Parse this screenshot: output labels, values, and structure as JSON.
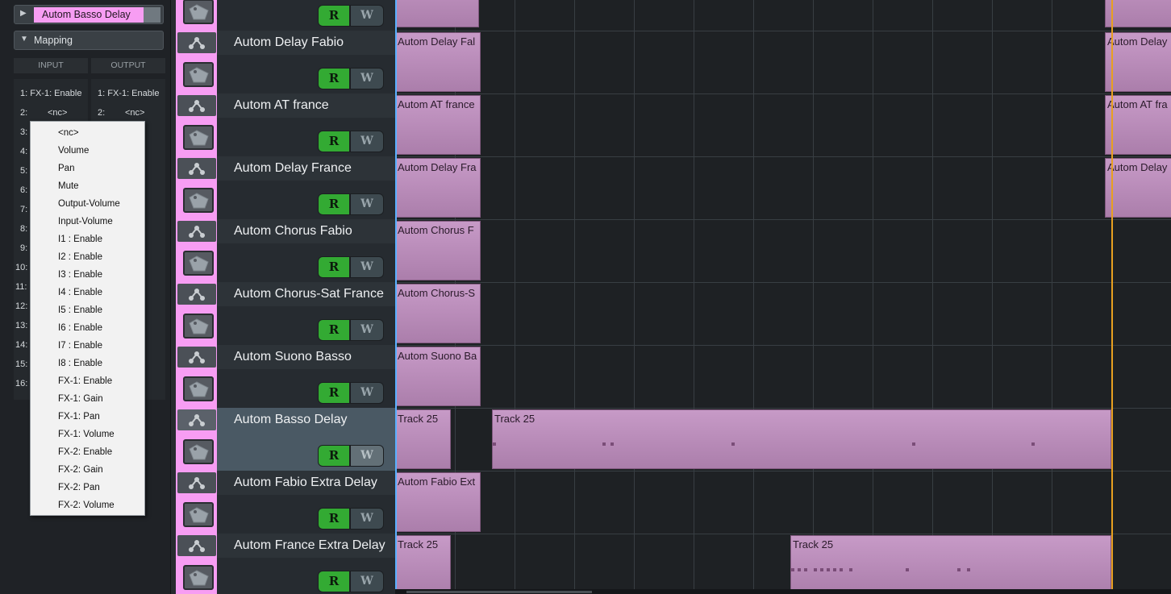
{
  "left_panel": {
    "autom_header": {
      "label": "Autom Basso Delay",
      "expand_icon": "play-triangle"
    },
    "mapping_header": {
      "label": "Mapping",
      "expand_icon": "down-triangle"
    },
    "input_header": "INPUT",
    "output_header": "OUTPUT",
    "input_rows": [
      "1: FX-1: Enable",
      "2:",
      "3:",
      "4:",
      "5:",
      "6:",
      "7:",
      "8:",
      "9:",
      "10:",
      "11:",
      "12:",
      "13:",
      "14:",
      "15:",
      "16:"
    ],
    "input_row2_value": "<nc>",
    "output_rows": [
      "1: FX-1: Enable",
      "2:"
    ],
    "output_row2_value": "<nc>"
  },
  "dropdown": {
    "items": [
      "<nc>",
      "Volume",
      "Pan",
      "Mute",
      "Output-Volume",
      "Input-Volume",
      "I1 : Enable",
      "I2 : Enable",
      "I3 : Enable",
      "I4 : Enable",
      "I5 : Enable",
      "I6 : Enable",
      "I7 : Enable",
      "I8 : Enable",
      "FX-1: Enable",
      "FX-1: Gain",
      "FX-1: Pan",
      "FX-1: Volume",
      "FX-2: Enable",
      "FX-2: Gain",
      "FX-2: Pan",
      "FX-2: Volume"
    ]
  },
  "buttons": {
    "read": "R",
    "write": "W"
  },
  "tracks": [
    {
      "name": ""
    },
    {
      "name": "Autom Delay Fabio"
    },
    {
      "name": "Autom AT france"
    },
    {
      "name": "Autom Delay France"
    },
    {
      "name": "Autom Chorus Fabio"
    },
    {
      "name": "Autom Chorus-Sat France"
    },
    {
      "name": "Autom Suono Basso"
    },
    {
      "name": "Autom Basso Delay",
      "selected": true
    },
    {
      "name": "Autom Fabio Extra Delay"
    },
    {
      "name": "Autom France Extra Delay"
    }
  ],
  "clips": {
    "c0a": "",
    "c0b": "",
    "c1a": "Autom Delay Fal",
    "c1b": "Autom Delay",
    "c2a": "Autom AT france",
    "c2b": "Autom AT fra",
    "c3a": "Autom Delay Fra",
    "c3b": "Autom Delay",
    "c4a": "Autom Chorus F",
    "c5a": "Autom Chorus-S",
    "c6a": "Autom Suono Ba",
    "c7a": "Track 25",
    "c7b": "Track 25",
    "c8a": "Autom Fabio Ext",
    "c9a": "Track 25",
    "c9b": "Track 25"
  },
  "colors": {
    "track_pink": "#f79df3",
    "read_green": "#33aa33",
    "clip_purple": "#c79ac7",
    "start_cursor": "#5ab0ff",
    "end_cursor": "#e8a020"
  }
}
